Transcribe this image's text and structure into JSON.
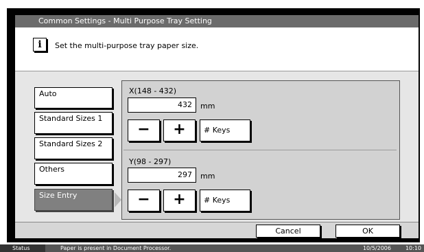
{
  "window": {
    "title": "Common Settings - Multi Purpose Tray Setting"
  },
  "message": {
    "icon": "info-icon",
    "icon_glyph": "i",
    "text": "Set the multi-purpose tray paper size."
  },
  "size_options": [
    {
      "label": "Auto",
      "selected": false
    },
    {
      "label": "Standard Sizes 1",
      "selected": false
    },
    {
      "label": "Standard Sizes 2",
      "selected": false
    },
    {
      "label": "Others",
      "selected": false
    },
    {
      "label": "Size Entry",
      "selected": true
    }
  ],
  "x_field": {
    "label": "X(148 - 432)",
    "value": "432",
    "unit": "mm",
    "minus": "−",
    "plus": "+",
    "keys_label": "# Keys"
  },
  "y_field": {
    "label": "Y(98 - 297)",
    "value": "297",
    "unit": "mm",
    "minus": "−",
    "plus": "+",
    "keys_label": "# Keys"
  },
  "actions": {
    "cancel": "Cancel",
    "ok": "OK"
  },
  "status": {
    "label": "Status",
    "message": "Paper is present in Document Processor.",
    "date": "10/5/2006",
    "time": "10:10"
  }
}
